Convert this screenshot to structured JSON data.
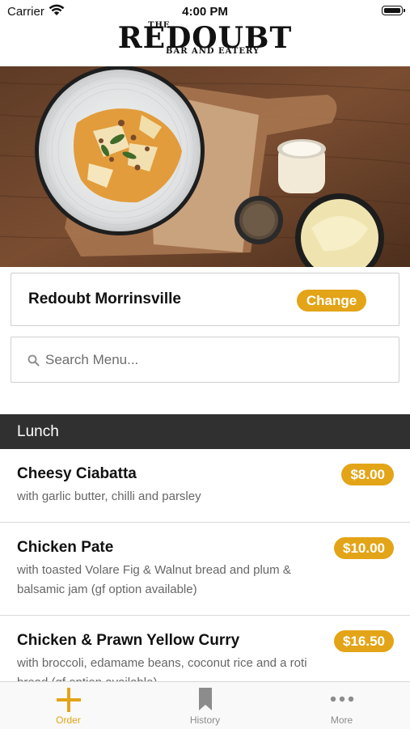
{
  "status_bar": {
    "carrier": "Carrier",
    "time": "4:00 PM"
  },
  "logo": {
    "line1": "THE",
    "name": "Redoubt",
    "tagline": "BAR AND EATERY"
  },
  "location": {
    "name": "Redoubt Morrinsville",
    "change_label": "Change"
  },
  "search": {
    "placeholder": "Search Menu..."
  },
  "section": {
    "title": "Lunch"
  },
  "menu_items": [
    {
      "title": "Cheesy Ciabatta",
      "description": "with garlic butter, chilli and parsley",
      "price": "$8.00"
    },
    {
      "title": "Chicken Pate",
      "description": "with toasted Volare Fig & Walnut bread and plum & balsamic jam (gf option available)",
      "price": "$10.00"
    },
    {
      "title": "Chicken & Prawn Yellow Curry",
      "description": "with broccoli, edamame beans, coconut rice and a roti bread (gf option available)",
      "price": "$16.50"
    }
  ],
  "tabs": [
    {
      "label": "Order",
      "icon": "plus-icon",
      "active": true
    },
    {
      "label": "History",
      "icon": "bookmark-icon",
      "active": false
    },
    {
      "label": "More",
      "icon": "more-dots-icon",
      "active": false
    }
  ],
  "colors": {
    "accent": "#e3a417",
    "section_bg": "#303030",
    "tab_inactive": "#8c8c8c"
  }
}
